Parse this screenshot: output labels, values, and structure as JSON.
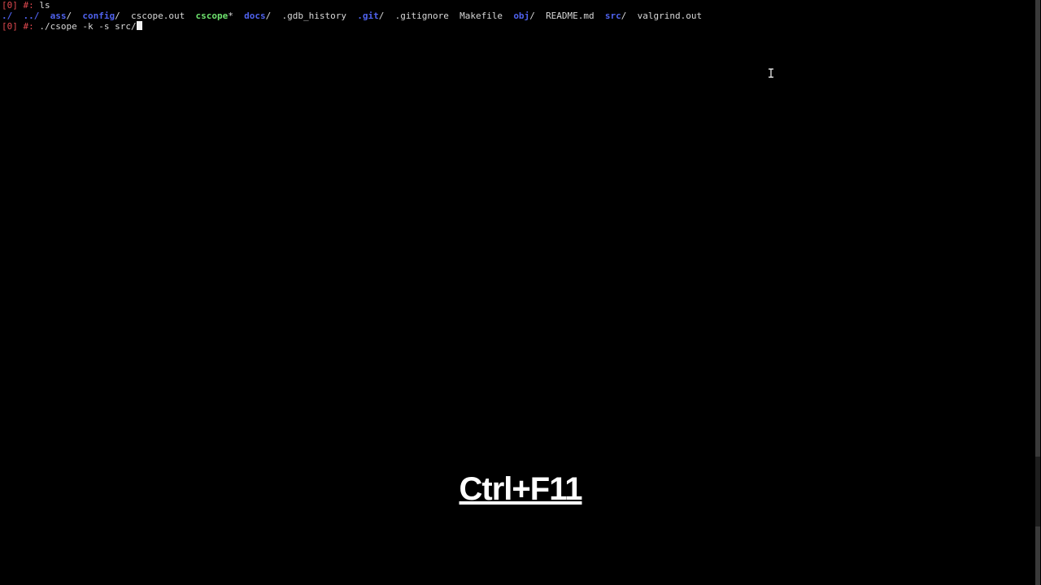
{
  "terminal": {
    "line1": {
      "prompt": "[0] #:",
      "command": "ls"
    },
    "listing": [
      {
        "text": "./",
        "color": "blue",
        "suffix": "  "
      },
      {
        "text": "../",
        "color": "blue",
        "suffix": "  "
      },
      {
        "text": "ass",
        "color": "blue",
        "suffix": "/  "
      },
      {
        "text": "config",
        "color": "blue",
        "suffix": "/  "
      },
      {
        "text": "cscope.out",
        "color": "plain",
        "suffix": "  "
      },
      {
        "text": "cscope",
        "color": "green",
        "suffix": "*  "
      },
      {
        "text": "docs",
        "color": "blue",
        "suffix": "/  "
      },
      {
        "text": ".gdb_history",
        "color": "plain",
        "suffix": "  "
      },
      {
        "text": ".git",
        "color": "blue",
        "suffix": "/  "
      },
      {
        "text": ".gitignore",
        "color": "plain",
        "suffix": "  "
      },
      {
        "text": "Makefile",
        "color": "plain",
        "suffix": "  "
      },
      {
        "text": "obj",
        "color": "blue",
        "suffix": "/  "
      },
      {
        "text": "README.md",
        "color": "plain",
        "suffix": "  "
      },
      {
        "text": "src",
        "color": "blue",
        "suffix": "/  "
      },
      {
        "text": "valgrind.out",
        "color": "plain",
        "suffix": ""
      }
    ],
    "line3": {
      "prompt": "[0] #:",
      "command": "./csope -k -s src/"
    }
  },
  "overlay": {
    "keystroke": "Ctrl+F11"
  },
  "colors": {
    "prompt": "#e0494f",
    "dir": "#4f62ee",
    "exec": "#6ee36e",
    "text": "#d8d8d8",
    "background": "#000000"
  },
  "icons": {
    "mouse_cursor": "i-beam-cursor-icon"
  }
}
